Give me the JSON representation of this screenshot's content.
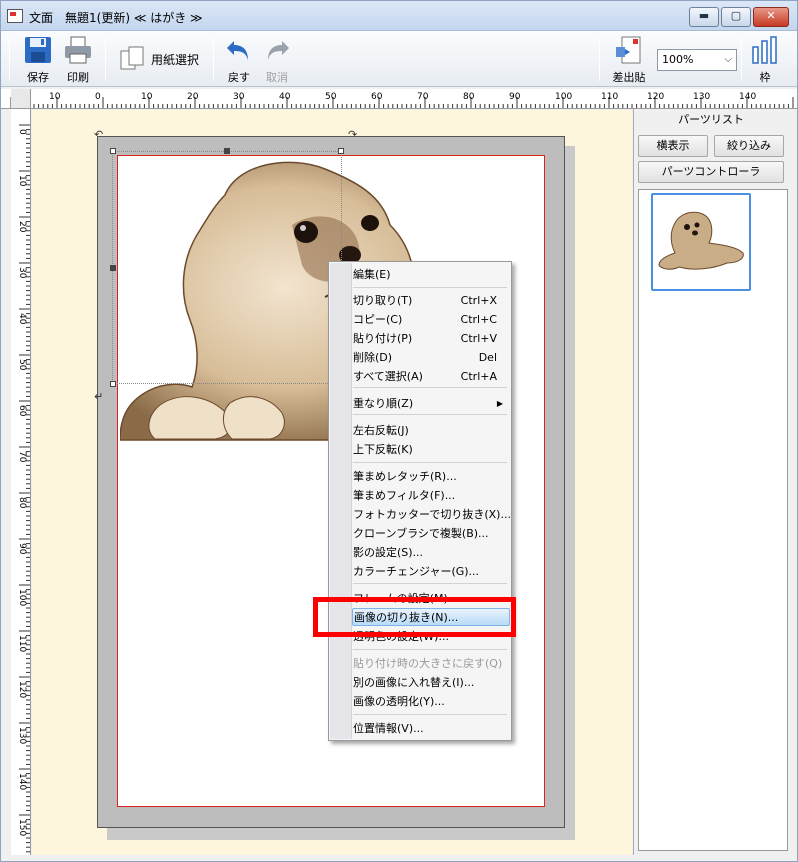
{
  "window": {
    "title": "文面　無題1(更新) ≪ はがき ≫",
    "controls": {
      "minimize": "▬",
      "maximize": "▢",
      "close": "✕"
    }
  },
  "toolbar": {
    "save_label": "保存",
    "print_label": "印刷",
    "paper_select_label": "用紙選択",
    "undo_label": "戻す",
    "redo_label": "取消",
    "insert_label": "差出貼",
    "zoom_value": "100%",
    "frame_label": "枠"
  },
  "rulers": {
    "top_ticks": [
      "10",
      "0",
      "10",
      "20",
      "30",
      "40",
      "50",
      "60",
      "70",
      "80",
      "90",
      "100",
      "110",
      "120",
      "130",
      "140"
    ],
    "left_ticks": [
      "0",
      "10",
      "20",
      "30",
      "40",
      "50",
      "60",
      "70",
      "80",
      "90",
      "100",
      "110",
      "120",
      "130",
      "140",
      "150"
    ]
  },
  "context_menu": {
    "items": [
      {
        "label": "編集(E)"
      },
      {
        "label": "切り取り(T)",
        "shortcut": "Ctrl+X"
      },
      {
        "label": "コピー(C)",
        "shortcut": "Ctrl+C"
      },
      {
        "label": "貼り付け(P)",
        "shortcut": "Ctrl+V"
      },
      {
        "label": "削除(D)",
        "shortcut": "Del"
      },
      {
        "label": "すべて選択(A)",
        "shortcut": "Ctrl+A"
      },
      {
        "label": "重なり順(Z)"
      },
      {
        "label": "左右反転(J)"
      },
      {
        "label": "上下反転(K)"
      },
      {
        "label": "筆まめレタッチ(R)..."
      },
      {
        "label": "筆まめフィルタ(F)..."
      },
      {
        "label": "フォトカッターで切り抜き(X)..."
      },
      {
        "label": "クローンブラシで複製(B)..."
      },
      {
        "label": "影の設定(S)..."
      },
      {
        "label": "カラーチェンジャー(G)..."
      },
      {
        "label": "フレームの設定(M)..."
      },
      {
        "label": "画像の切り抜き(N)..."
      },
      {
        "label": "透明色の設定(W)..."
      },
      {
        "label": "貼り付け時の大きさに戻す(Q)"
      },
      {
        "label": "別の画像に入れ替え(I)..."
      },
      {
        "label": "画像の透明化(Y)..."
      },
      {
        "label": "位置情報(V)..."
      }
    ],
    "submenu_arrow": "▶"
  },
  "panel": {
    "title": "パーツリスト",
    "horizontal_button": "横表示",
    "filter_button": "絞り込み",
    "controller_button": "パーツコントローラ"
  },
  "colors": {
    "highlight_box": "#ff0000",
    "canvas_bg": "#fdf5dc",
    "selection_blue": "#4a90e2"
  }
}
